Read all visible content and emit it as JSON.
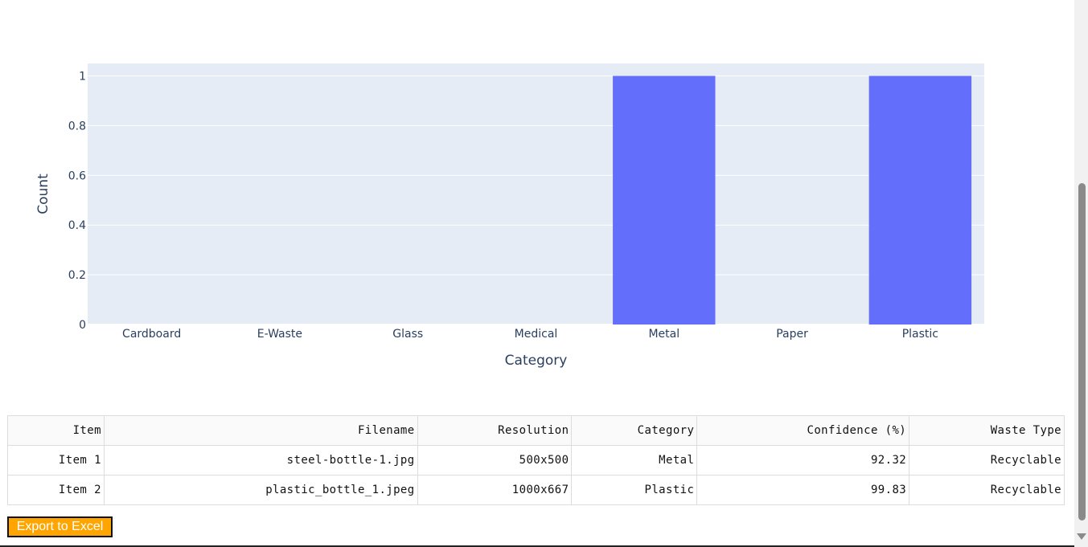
{
  "chart_data": {
    "type": "bar",
    "categories": [
      "Cardboard",
      "E-Waste",
      "Glass",
      "Medical",
      "Metal",
      "Paper",
      "Plastic"
    ],
    "values": [
      0,
      0,
      0,
      0,
      1,
      0,
      1
    ],
    "xlabel": "Category",
    "ylabel": "Count",
    "ylim": [
      0,
      1.05
    ],
    "yticks": [
      0,
      0.2,
      0.4,
      0.6,
      0.8,
      1
    ],
    "ytick_labels": [
      "0",
      "0.2",
      "0.4",
      "0.6",
      "0.8",
      "1"
    ],
    "grid": true,
    "bar_color": "#636efa",
    "plot_background": "#e5ecf6"
  },
  "table": {
    "headers": [
      "Item",
      "Filename",
      "Resolution",
      "Category",
      "Confidence (%)",
      "Waste Type"
    ],
    "rows": [
      [
        "Item 1",
        "steel-bottle-1.jpg",
        "500x500",
        "Metal",
        "92.32",
        "Recyclable"
      ],
      [
        "Item 2",
        "plastic_bottle_1.jpeg",
        "1000x667",
        "Plastic",
        "99.83",
        "Recyclable"
      ]
    ]
  },
  "export_button": {
    "label": "Export to Excel",
    "color": "#ffa500"
  }
}
